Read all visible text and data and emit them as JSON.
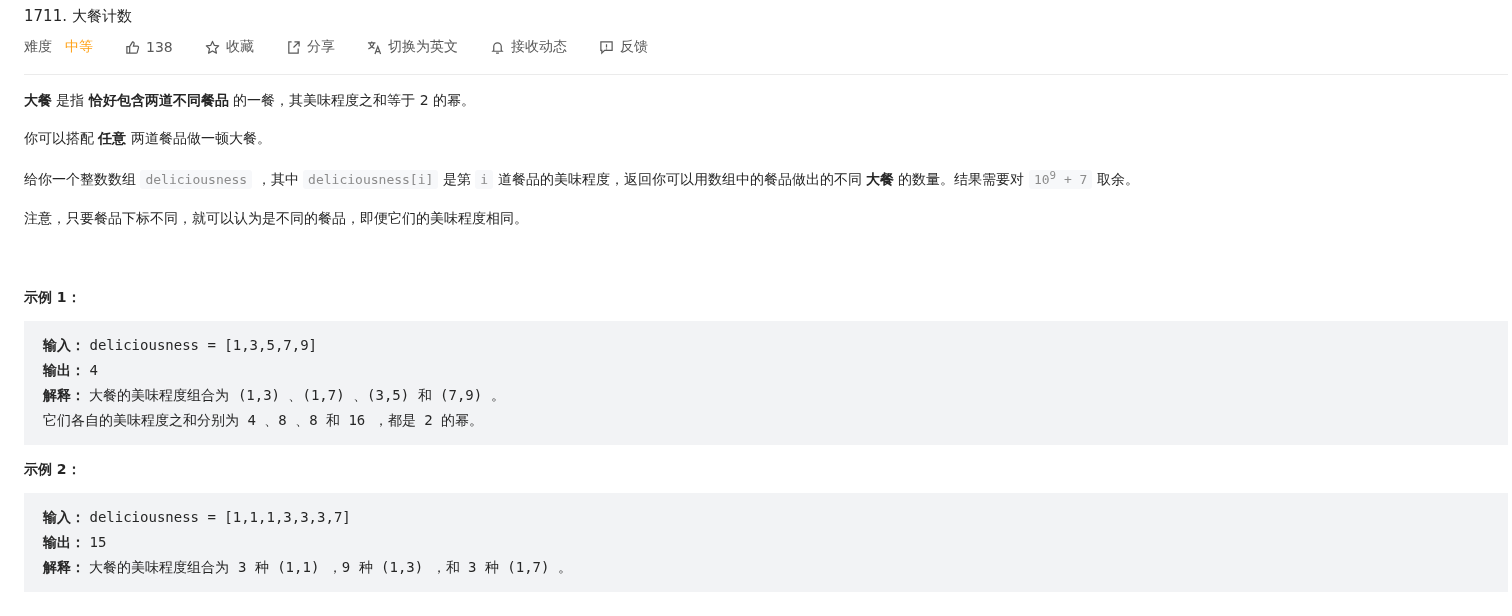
{
  "title": "1711. 大餐计数",
  "toolbar": [
    {
      "kind": "difficulty",
      "label": "难度",
      "value": "中等"
    },
    {
      "kind": "like",
      "label": "138"
    },
    {
      "kind": "star",
      "label": "收藏"
    },
    {
      "kind": "share",
      "label": "分享"
    },
    {
      "kind": "translate",
      "label": "切换为英文"
    },
    {
      "kind": "bell",
      "label": "接收动态"
    },
    {
      "kind": "feedback",
      "label": "反馈"
    }
  ],
  "paragraphs": [
    [
      {
        "kind": "text",
        "text": "**大餐** 是指 **恰好包含两道不同餐品** 的一餐，其美味程度之和等于 2 的幂。"
      }
    ],
    [
      {
        "kind": "text",
        "text": "你可以搭配 **任意** 两道餐品做一顿大餐。"
      }
    ],
    [
      {
        "kind": "text",
        "text": "给你一个整数数组 "
      },
      {
        "kind": "code",
        "text": "deliciousness"
      },
      {
        "kind": "text",
        "text": " ，其中 "
      },
      {
        "kind": "code",
        "text": "deliciousness[i]"
      },
      {
        "kind": "text",
        "text": " 是第 "
      },
      {
        "kind": "code",
        "text": "i"
      },
      {
        "kind": "text",
        "text": " 道餐品的美味程度，返回你可以用数组中的餐品做出的不同 **大餐** 的数量。结果需要对 "
      },
      {
        "kind": "code",
        "text": "10$^{9}$ + 7"
      },
      {
        "kind": "text",
        "text": " 取余。"
      }
    ],
    [
      {
        "kind": "text",
        "text": "注意，只要餐品下标不同，就可以认为是不同的餐品，即便它们的美味程度相同。"
      }
    ]
  ],
  "examples": [
    {
      "heading": "示例 1：",
      "lines": [
        {
          "label": "输入：",
          "value": "deliciousness = [1,3,5,7,9]"
        },
        {
          "label": "输出：",
          "value": "4"
        },
        {
          "label": "解释：",
          "value": "大餐的美味程度组合为 (1,3) 、(1,7) 、(3,5) 和 (7,9) 。"
        },
        {
          "value": "它们各自的美味程度之和分别为 4 、8 、8 和 16 ，都是 2 的幂。"
        }
      ]
    },
    {
      "heading": "示例 2：",
      "lines": [
        {
          "label": "输入：",
          "value": "deliciousness = [1,1,1,3,3,3,7]"
        },
        {
          "label": "输出：",
          "value": "15"
        },
        {
          "label": "解释：",
          "value": "大餐的美味程度组合为 3 种 (1,1) ，9 种 (1,3) ，和 3 种 (1,7) 。"
        }
      ]
    }
  ]
}
